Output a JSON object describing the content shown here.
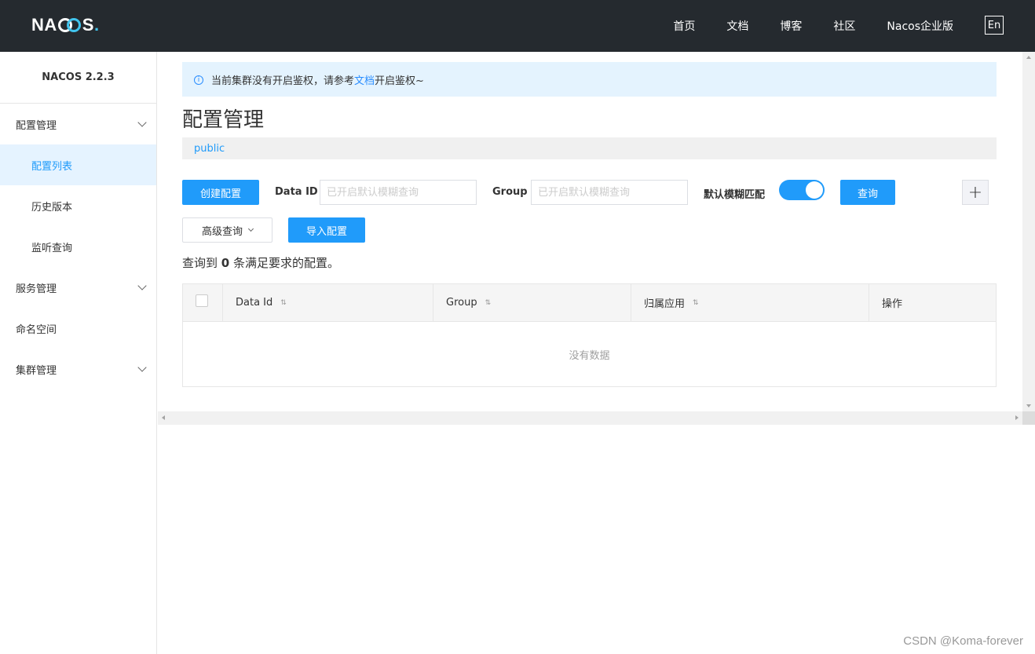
{
  "header": {
    "logo_left": "NA",
    "logo_right": "S",
    "logo_dot": ".",
    "nav": [
      "首页",
      "文档",
      "博客",
      "社区",
      "Nacos企业版"
    ],
    "lang": "En"
  },
  "sidebar": {
    "version": "NACOS 2.2.3",
    "items": [
      {
        "label": "配置管理",
        "expandable": true
      },
      {
        "label": "配置列表",
        "active": true
      },
      {
        "label": "历史版本"
      },
      {
        "label": "监听查询"
      },
      {
        "label": "服务管理",
        "expandable": true
      },
      {
        "label": "命名空间"
      },
      {
        "label": "集群管理",
        "expandable": true
      }
    ]
  },
  "notice": {
    "icon": "i",
    "text_before": "当前集群没有开启鉴权，请参考",
    "link": "文档",
    "text_after": "开启鉴权~"
  },
  "page": {
    "title": "配置管理",
    "namespace": "public"
  },
  "toolbar": {
    "create_label": "创建配置",
    "data_id_label": "Data ID",
    "data_id_placeholder": "已开启默认模糊查询",
    "group_label": "Group",
    "group_placeholder": "已开启默认模糊查询",
    "fuzzy_label": "默认模糊匹配",
    "fuzzy_on": true,
    "query_label": "查询",
    "plus_label": "+",
    "advanced_label": "高级查询",
    "import_label": "导入配置"
  },
  "result": {
    "prefix": "查询到",
    "count": "0",
    "suffix": "条满足要求的配置。"
  },
  "table": {
    "columns": [
      "Data Id",
      "Group",
      "归属应用",
      "操作"
    ],
    "sort_glyph": "⇅",
    "empty": "没有数据"
  },
  "watermark": "CSDN @Koma-forever",
  "colors": {
    "primary": "#209bfa",
    "header_bg": "#252a2f",
    "notice_bg": "#e4f3fe",
    "logo_accent": "#41c4ed"
  }
}
